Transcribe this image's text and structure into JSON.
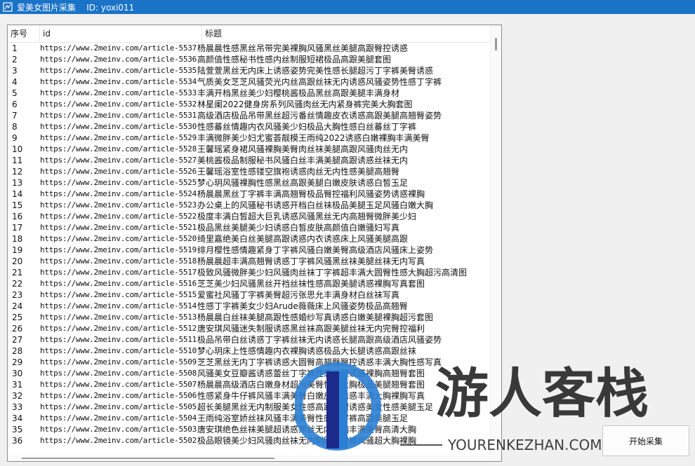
{
  "window": {
    "title": "爱美女图片采集    ID: yoxi011"
  },
  "table": {
    "columns": [
      "序号",
      "id",
      "标题"
    ],
    "rows": [
      [
        "1",
        "https://www.2meinv.com/article-5537",
        "杨晨晨性感黑丝吊带完美裸胸风骚黑丝美腿高跟臀控诱惑"
      ],
      [
        "2",
        "https://www.2meinv.com/article-5536",
        "高颜值性感秘书性感内丝制服短裙极品高跟美腿套图"
      ],
      [
        "3",
        "https://www.2meinv.com/article-5535",
        "陆萱萱黑丝无内床上诱惑姿势完美性感长腿超污丁字裤美臀诱惑"
      ],
      [
        "4",
        "https://www.2meinv.com/article-5534",
        "气质美女芝芝风骚荧光内丝高跟丝袜无内诱惑风骚姿势性感丁字裤"
      ],
      [
        "5",
        "https://www.2meinv.com/article-5533",
        "丰满开档黑丝美少妇樱桃酱极品黑丝高跟美腿丰满身材"
      ],
      [
        "6",
        "https://www.2meinv.com/article-5532",
        "林星阑2022健身房系列风骚肉丝无内紧身裤完美大胸套图"
      ],
      [
        "7",
        "https://www.2meinv.com/article-5531",
        "高级酒店极品吊带黑丝超污番丝情趣皮衣诱惑高跟美腿高翘臀姿势"
      ],
      [
        "8",
        "https://www.2meinv.com/article-5530",
        "性感蕃丝情趣内衣风骚美少妇极品大胸性感白丝蕃丝丁字裤"
      ],
      [
        "9",
        "https://www.2meinv.com/article-5529",
        "丰满微胖美少妇尤蜜荟靓模王雨纯2022诱惑白嫩裸胸丰满美臀"
      ],
      [
        "10",
        "https://www.2meinv.com/article-5528",
        "王馨瑶紧身裙风骚裸胸美臀肉丝袜美腿高跟风骚肉丝无内"
      ],
      [
        "11",
        "https://www.2meinv.com/article-5527",
        "美桃酱极品制服秘书风骚白丝丰满美腿高跟诱惑丝袜无内"
      ],
      [
        "12",
        "https://www.2meinv.com/article-5526",
        "王馨瑶浴室性感镂空旗袍诱惑肉丝无内性感美腿高翘臀"
      ],
      [
        "13",
        "https://www.2meinv.com/article-5525",
        "梦心玥风骚裸胸性感黑丝高跟美腿白嫩皮肤诱惑白皙玉足"
      ],
      [
        "14",
        "https://www.2meinv.com/article-5524",
        "杨晨晨黑丝丁字裤丰满高翘臀极品臀控福利风骚姿势诱惑裸胸"
      ],
      [
        "15",
        "https://www.2meinv.com/article-5523",
        "办公桌上的风骚秘书诱惑开档白丝袜极品美腿玉足风骚白嫩大胸"
      ],
      [
        "16",
        "https://www.2meinv.com/article-5522",
        "极度丰满白皙超大巨乳诱惑风骚黑丝无内高翘臀微胖美少妇"
      ],
      [
        "17",
        "https://www.2meinv.com/article-5521",
        "极品黑丝美腿美少妇诱惑白皙皮肤高颜值白嫩骚妇写真"
      ],
      [
        "18",
        "https://www.2meinv.com/article-5520",
        "绮里嘉绝美白丝美腿高跟诱惑内衣诱惑床上风骚美腿高跟"
      ],
      [
        "19",
        "https://www.2meinv.com/article-5519",
        "绯月樱性感情趣紧身丁字裤风骚白嫩美臀高级酒店风骚床上姿势"
      ],
      [
        "20",
        "https://www.2meinv.com/article-5518",
        "杨晨晨超丰满高翘臀诱惑丁字裤风骚黑丝袜美腿丝袜无内写真"
      ],
      [
        "21",
        "https://www.2meinv.com/article-5517",
        "极致风骚微胖美少妇风骚肉丝袜丁字裤超丰满大圆臀性感大胸超污高清图"
      ],
      [
        "22",
        "https://www.2meinv.com/article-5516",
        "芝芝美少妇风骚黑丝开裆丝袜性感高跟美腿诱惑裸胸写真套图"
      ],
      [
        "23",
        "https://www.2meinv.com/article-5515",
        "爱蜜社风骚丁字裤美臀超污张思允丰满身材白丝袜写真"
      ],
      [
        "24",
        "https://www.2meinv.com/article-5514",
        "性感丁字裤美女少妇Arude薇薇床上风骚姿势极品高翘臀"
      ],
      [
        "25",
        "https://www.2meinv.com/article-5513",
        "杨晨晨白丝袜美腿高跟性感婚纱写真诱惑白嫩美腿裸胸超污套图"
      ],
      [
        "26",
        "https://www.2meinv.com/article-5512",
        "唐安琪风骚迷失制服诱惑黑丝袜高跟美腿丝袜无内完臀控福利"
      ],
      [
        "27",
        "https://www.2meinv.com/article-5511",
        "极品吊带白丝诱惑丁字裤丝袜无内诱惑长腿高跟高级酒店风骚姿势"
      ],
      [
        "28",
        "https://www.2meinv.com/article-5510",
        "梦心玥床上性感情趣内衣裸胸诱惑极品大长腿诱惑高跟丝袜"
      ],
      [
        "29",
        "https://www.2meinv.com/article-5509",
        "芝芝黑丝无内丁字裤诱惑大圆臀高翘臀臀控诱惑丰满大胸性感写真"
      ],
      [
        "30",
        "https://www.2meinv.com/article-5508",
        "风骚美女豆瓣酱诱惑蕾丝丁字裤性感美腿诱惑裸胸高翘臀套图"
      ],
      [
        "31",
        "https://www.2meinv.com/article-5507",
        "杨晨晨高级酒店白嫩身材超污美臀性感大胸极品美腿翘臀套图"
      ],
      [
        "32",
        "https://www.2meinv.com/article-5506",
        "性感紧身牛仔裤风骚丰满美臀白嫩皮肤诱惑丰满大胸裸胸写真"
      ],
      [
        "33",
        "https://www.2meinv.com/article-5505",
        "超长美腿黑丝无内制服美女性感高跟美腿诱惑美女性感美腿玉足"
      ],
      [
        "34",
        "https://www.2meinv.com/article-5504",
        "王雨纯浴室娇丝袜风骚丰满美臀性感丁字裤高跟美腿玉足"
      ],
      [
        "35",
        "https://www.2meinv.com/article-5503",
        "唐安琪绝色丝袜美腿超诱惑黑丝无内大胸丰满美臀高清大胸"
      ],
      [
        "36",
        "https://www.2meinv.com/article-5502",
        "极品眼镜美少妇风骚肉丝袜无内制服丁字裤风骚超大胸裸胸"
      ]
    ]
  },
  "start_button": {
    "label": "开始采集"
  },
  "watermark": {
    "text": "游人客栈",
    "url": "YOURENKEZHAN.COM"
  },
  "colors": {
    "titlebar": "#1a73c7",
    "watermark_blue": "#2b7fd4",
    "watermark_navy": "#1c2a8c"
  }
}
